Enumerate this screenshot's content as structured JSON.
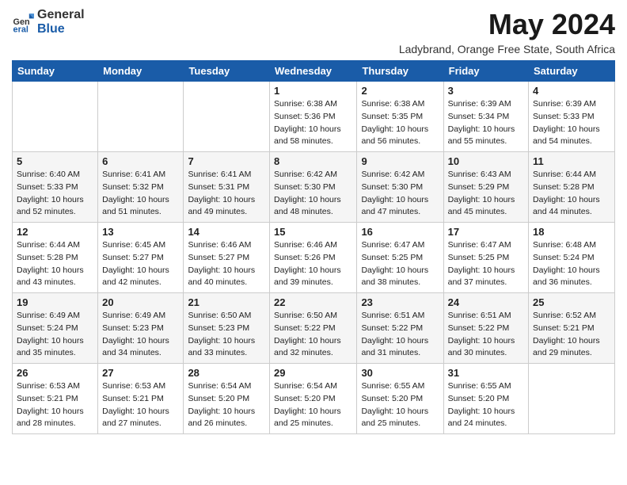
{
  "logo": {
    "general": "General",
    "blue": "Blue"
  },
  "title": "May 2024",
  "subtitle": "Ladybrand, Orange Free State, South Africa",
  "headers": [
    "Sunday",
    "Monday",
    "Tuesday",
    "Wednesday",
    "Thursday",
    "Friday",
    "Saturday"
  ],
  "rows": [
    [
      {
        "day": "",
        "info": ""
      },
      {
        "day": "",
        "info": ""
      },
      {
        "day": "",
        "info": ""
      },
      {
        "day": "1",
        "info": "Sunrise: 6:38 AM\nSunset: 5:36 PM\nDaylight: 10 hours\nand 58 minutes."
      },
      {
        "day": "2",
        "info": "Sunrise: 6:38 AM\nSunset: 5:35 PM\nDaylight: 10 hours\nand 56 minutes."
      },
      {
        "day": "3",
        "info": "Sunrise: 6:39 AM\nSunset: 5:34 PM\nDaylight: 10 hours\nand 55 minutes."
      },
      {
        "day": "4",
        "info": "Sunrise: 6:39 AM\nSunset: 5:33 PM\nDaylight: 10 hours\nand 54 minutes."
      }
    ],
    [
      {
        "day": "5",
        "info": "Sunrise: 6:40 AM\nSunset: 5:33 PM\nDaylight: 10 hours\nand 52 minutes."
      },
      {
        "day": "6",
        "info": "Sunrise: 6:41 AM\nSunset: 5:32 PM\nDaylight: 10 hours\nand 51 minutes."
      },
      {
        "day": "7",
        "info": "Sunrise: 6:41 AM\nSunset: 5:31 PM\nDaylight: 10 hours\nand 49 minutes."
      },
      {
        "day": "8",
        "info": "Sunrise: 6:42 AM\nSunset: 5:30 PM\nDaylight: 10 hours\nand 48 minutes."
      },
      {
        "day": "9",
        "info": "Sunrise: 6:42 AM\nSunset: 5:30 PM\nDaylight: 10 hours\nand 47 minutes."
      },
      {
        "day": "10",
        "info": "Sunrise: 6:43 AM\nSunset: 5:29 PM\nDaylight: 10 hours\nand 45 minutes."
      },
      {
        "day": "11",
        "info": "Sunrise: 6:44 AM\nSunset: 5:28 PM\nDaylight: 10 hours\nand 44 minutes."
      }
    ],
    [
      {
        "day": "12",
        "info": "Sunrise: 6:44 AM\nSunset: 5:28 PM\nDaylight: 10 hours\nand 43 minutes."
      },
      {
        "day": "13",
        "info": "Sunrise: 6:45 AM\nSunset: 5:27 PM\nDaylight: 10 hours\nand 42 minutes."
      },
      {
        "day": "14",
        "info": "Sunrise: 6:46 AM\nSunset: 5:27 PM\nDaylight: 10 hours\nand 40 minutes."
      },
      {
        "day": "15",
        "info": "Sunrise: 6:46 AM\nSunset: 5:26 PM\nDaylight: 10 hours\nand 39 minutes."
      },
      {
        "day": "16",
        "info": "Sunrise: 6:47 AM\nSunset: 5:25 PM\nDaylight: 10 hours\nand 38 minutes."
      },
      {
        "day": "17",
        "info": "Sunrise: 6:47 AM\nSunset: 5:25 PM\nDaylight: 10 hours\nand 37 minutes."
      },
      {
        "day": "18",
        "info": "Sunrise: 6:48 AM\nSunset: 5:24 PM\nDaylight: 10 hours\nand 36 minutes."
      }
    ],
    [
      {
        "day": "19",
        "info": "Sunrise: 6:49 AM\nSunset: 5:24 PM\nDaylight: 10 hours\nand 35 minutes."
      },
      {
        "day": "20",
        "info": "Sunrise: 6:49 AM\nSunset: 5:23 PM\nDaylight: 10 hours\nand 34 minutes."
      },
      {
        "day": "21",
        "info": "Sunrise: 6:50 AM\nSunset: 5:23 PM\nDaylight: 10 hours\nand 33 minutes."
      },
      {
        "day": "22",
        "info": "Sunrise: 6:50 AM\nSunset: 5:22 PM\nDaylight: 10 hours\nand 32 minutes."
      },
      {
        "day": "23",
        "info": "Sunrise: 6:51 AM\nSunset: 5:22 PM\nDaylight: 10 hours\nand 31 minutes."
      },
      {
        "day": "24",
        "info": "Sunrise: 6:51 AM\nSunset: 5:22 PM\nDaylight: 10 hours\nand 30 minutes."
      },
      {
        "day": "25",
        "info": "Sunrise: 6:52 AM\nSunset: 5:21 PM\nDaylight: 10 hours\nand 29 minutes."
      }
    ],
    [
      {
        "day": "26",
        "info": "Sunrise: 6:53 AM\nSunset: 5:21 PM\nDaylight: 10 hours\nand 28 minutes."
      },
      {
        "day": "27",
        "info": "Sunrise: 6:53 AM\nSunset: 5:21 PM\nDaylight: 10 hours\nand 27 minutes."
      },
      {
        "day": "28",
        "info": "Sunrise: 6:54 AM\nSunset: 5:20 PM\nDaylight: 10 hours\nand 26 minutes."
      },
      {
        "day": "29",
        "info": "Sunrise: 6:54 AM\nSunset: 5:20 PM\nDaylight: 10 hours\nand 25 minutes."
      },
      {
        "day": "30",
        "info": "Sunrise: 6:55 AM\nSunset: 5:20 PM\nDaylight: 10 hours\nand 25 minutes."
      },
      {
        "day": "31",
        "info": "Sunrise: 6:55 AM\nSunset: 5:20 PM\nDaylight: 10 hours\nand 24 minutes."
      },
      {
        "day": "",
        "info": ""
      }
    ]
  ]
}
